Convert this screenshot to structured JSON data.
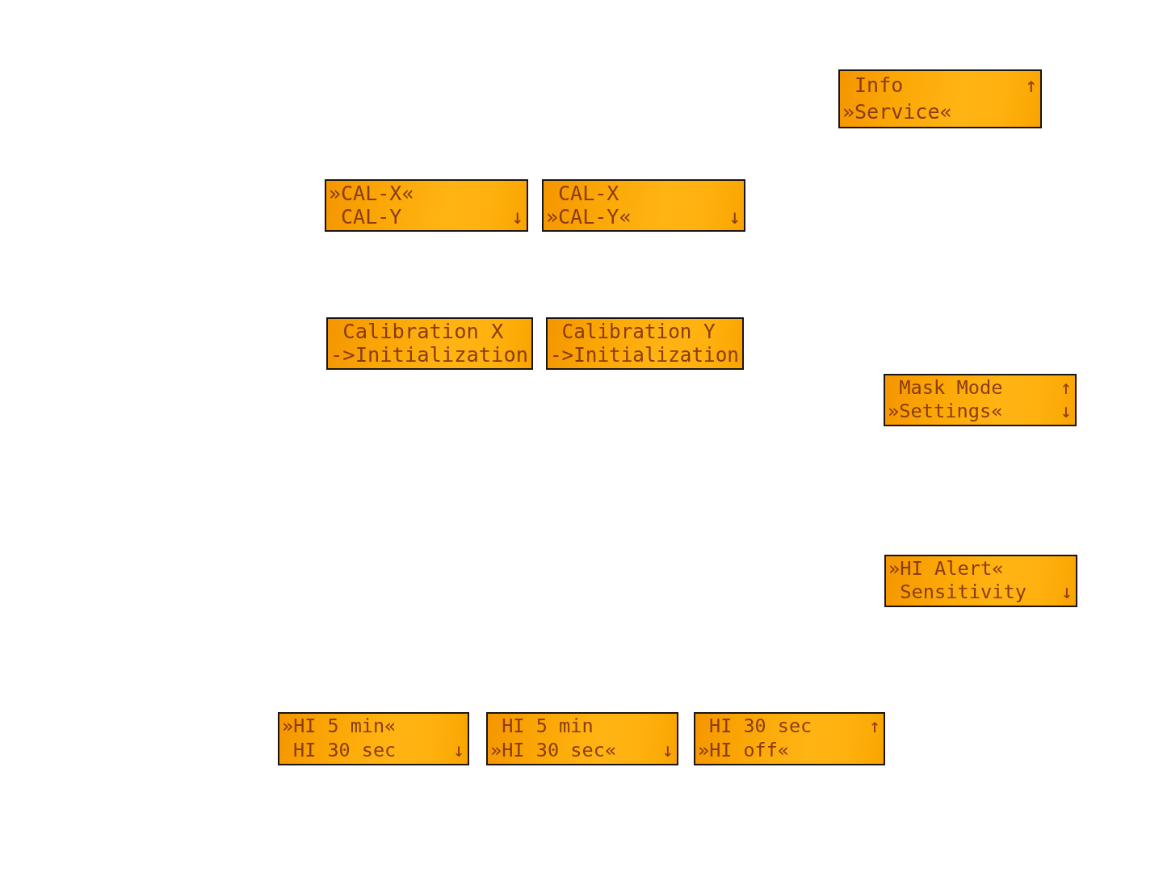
{
  "screens": [
    {
      "lines": [
        {
          "text": "Info",
          "arrow": "↑"
        },
        {
          "cursor": "»",
          "text": "Service",
          "cursor_end": "«"
        }
      ]
    },
    {
      "lines": [
        {
          "cursor": "»",
          "text": "CAL-X",
          "cursor_end": "«"
        },
        {
          "text": "CAL-Y",
          "arrow": "↓"
        }
      ]
    },
    {
      "lines": [
        {
          "text": "CAL-X"
        },
        {
          "cursor": "»",
          "text": "CAL-Y",
          "cursor_end": "«",
          "arrow": "↓"
        }
      ]
    },
    {
      "lines": [
        {
          "text": "Calibration X"
        },
        {
          "cursor": "->",
          "text": "Initialization"
        }
      ]
    },
    {
      "lines": [
        {
          "text": "Calibration Y"
        },
        {
          "cursor": "->",
          "text": "Initialization"
        }
      ]
    },
    {
      "lines": [
        {
          "text": "Mask Mode",
          "arrow": "↑"
        },
        {
          "cursor": "»",
          "text": "Settings",
          "cursor_end": "«",
          "arrow": "↓"
        }
      ]
    },
    {
      "lines": [
        {
          "cursor": "»",
          "text": "HI Alert",
          "cursor_end": "«"
        },
        {
          "text": "Sensitivity",
          "arrow": "↓"
        }
      ]
    },
    {
      "lines": [
        {
          "cursor": "»",
          "text": "HI 5 min",
          "cursor_end": "«"
        },
        {
          "text": "HI 30 sec",
          "arrow": "↓"
        }
      ]
    },
    {
      "lines": [
        {
          "text": "HI 5 min"
        },
        {
          "cursor": "»",
          "text": "HI 30 sec",
          "cursor_end": "«",
          "arrow": "↓"
        }
      ]
    },
    {
      "lines": [
        {
          "text": "HI 30 sec",
          "arrow": "↑"
        },
        {
          "cursor": "»",
          "text": "HI off",
          "cursor_end": "«"
        }
      ]
    }
  ]
}
